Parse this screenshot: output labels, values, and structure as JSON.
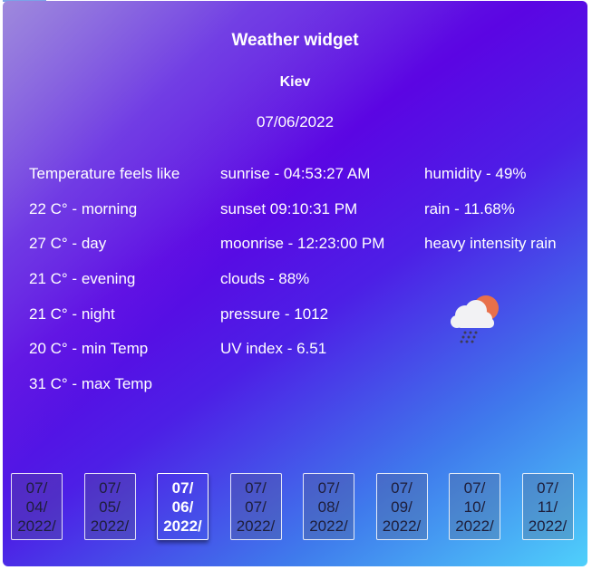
{
  "widget": {
    "title": "Weather widget",
    "city": "Kiev",
    "date": "07/06/2022"
  },
  "temps": [
    "Temperature feels like",
    "22 C° - morning",
    "27 C° - day",
    "21 C° - evening",
    "21 C° - night",
    "20 C° - min Temp",
    "31 C° - max Temp"
  ],
  "details": [
    "sunrise - 04:53:27 AM",
    "sunset 09:10:31 PM",
    "moonrise - 12:23:00 PM",
    "clouds - 88%",
    "pressure - 1012",
    "UV index - 6.51"
  ],
  "conditions": [
    "humidity - 49%",
    "rain - 11.68%",
    "heavy intensity rain"
  ],
  "icon": "cloud-sun-rain-icon",
  "days": [
    {
      "a": "07/",
      "b": "04/",
      "c": "2022/"
    },
    {
      "a": "07/",
      "b": "05/",
      "c": "2022/"
    },
    {
      "a": "07/",
      "b": "06/",
      "c": "2022/"
    },
    {
      "a": "07/",
      "b": "07/",
      "c": "2022/"
    },
    {
      "a": "07/",
      "b": "08/",
      "c": "2022/"
    },
    {
      "a": "07/",
      "b": "09/",
      "c": "2022/"
    },
    {
      "a": "07/",
      "b": "10/",
      "c": "2022/"
    },
    {
      "a": "07/",
      "b": "11/",
      "c": "2022/"
    }
  ],
  "colors": {
    "gradient_start": "#7b4fe0",
    "gradient_mid": "#5b05e3",
    "gradient_end": "#4fd0fb",
    "sun": "#e8704a",
    "cloud": "#f2f2f4"
  }
}
